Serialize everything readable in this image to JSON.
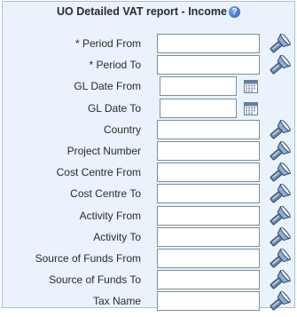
{
  "title": "UO Detailed VAT report - Income",
  "help_icon": "help-icon",
  "colors": {
    "panel_background": "#eaf2fb",
    "panel_border": "#a9bfd6",
    "help_blue": "#2455b8"
  },
  "fields": [
    {
      "label": "* Period From",
      "value": "",
      "type": "lov",
      "icon": "flashlight-search-icon"
    },
    {
      "label": "* Period To",
      "value": "",
      "type": "lov",
      "icon": "flashlight-search-icon"
    },
    {
      "label": "GL Date From",
      "value": "",
      "type": "date",
      "icon": "calendar-icon"
    },
    {
      "label": "GL Date To",
      "value": "",
      "type": "date",
      "icon": "calendar-icon"
    },
    {
      "label": "Country",
      "value": "",
      "type": "lov",
      "icon": "flashlight-search-icon"
    },
    {
      "label": "Project Number",
      "value": "",
      "type": "lov",
      "icon": "flashlight-search-icon"
    },
    {
      "label": "Cost Centre From",
      "value": "",
      "type": "lov",
      "icon": "flashlight-search-icon"
    },
    {
      "label": "Cost Centre To",
      "value": "",
      "type": "lov",
      "icon": "flashlight-search-icon"
    },
    {
      "label": "Activity From",
      "value": "",
      "type": "lov",
      "icon": "flashlight-search-icon"
    },
    {
      "label": "Activity To",
      "value": "",
      "type": "lov",
      "icon": "flashlight-search-icon"
    },
    {
      "label": "Source of Funds From",
      "value": "",
      "type": "lov",
      "icon": "flashlight-search-icon"
    },
    {
      "label": "Source of Funds To",
      "value": "",
      "type": "lov",
      "icon": "flashlight-search-icon"
    },
    {
      "label": "Tax Name",
      "value": "",
      "type": "lov",
      "icon": "flashlight-search-icon"
    }
  ]
}
